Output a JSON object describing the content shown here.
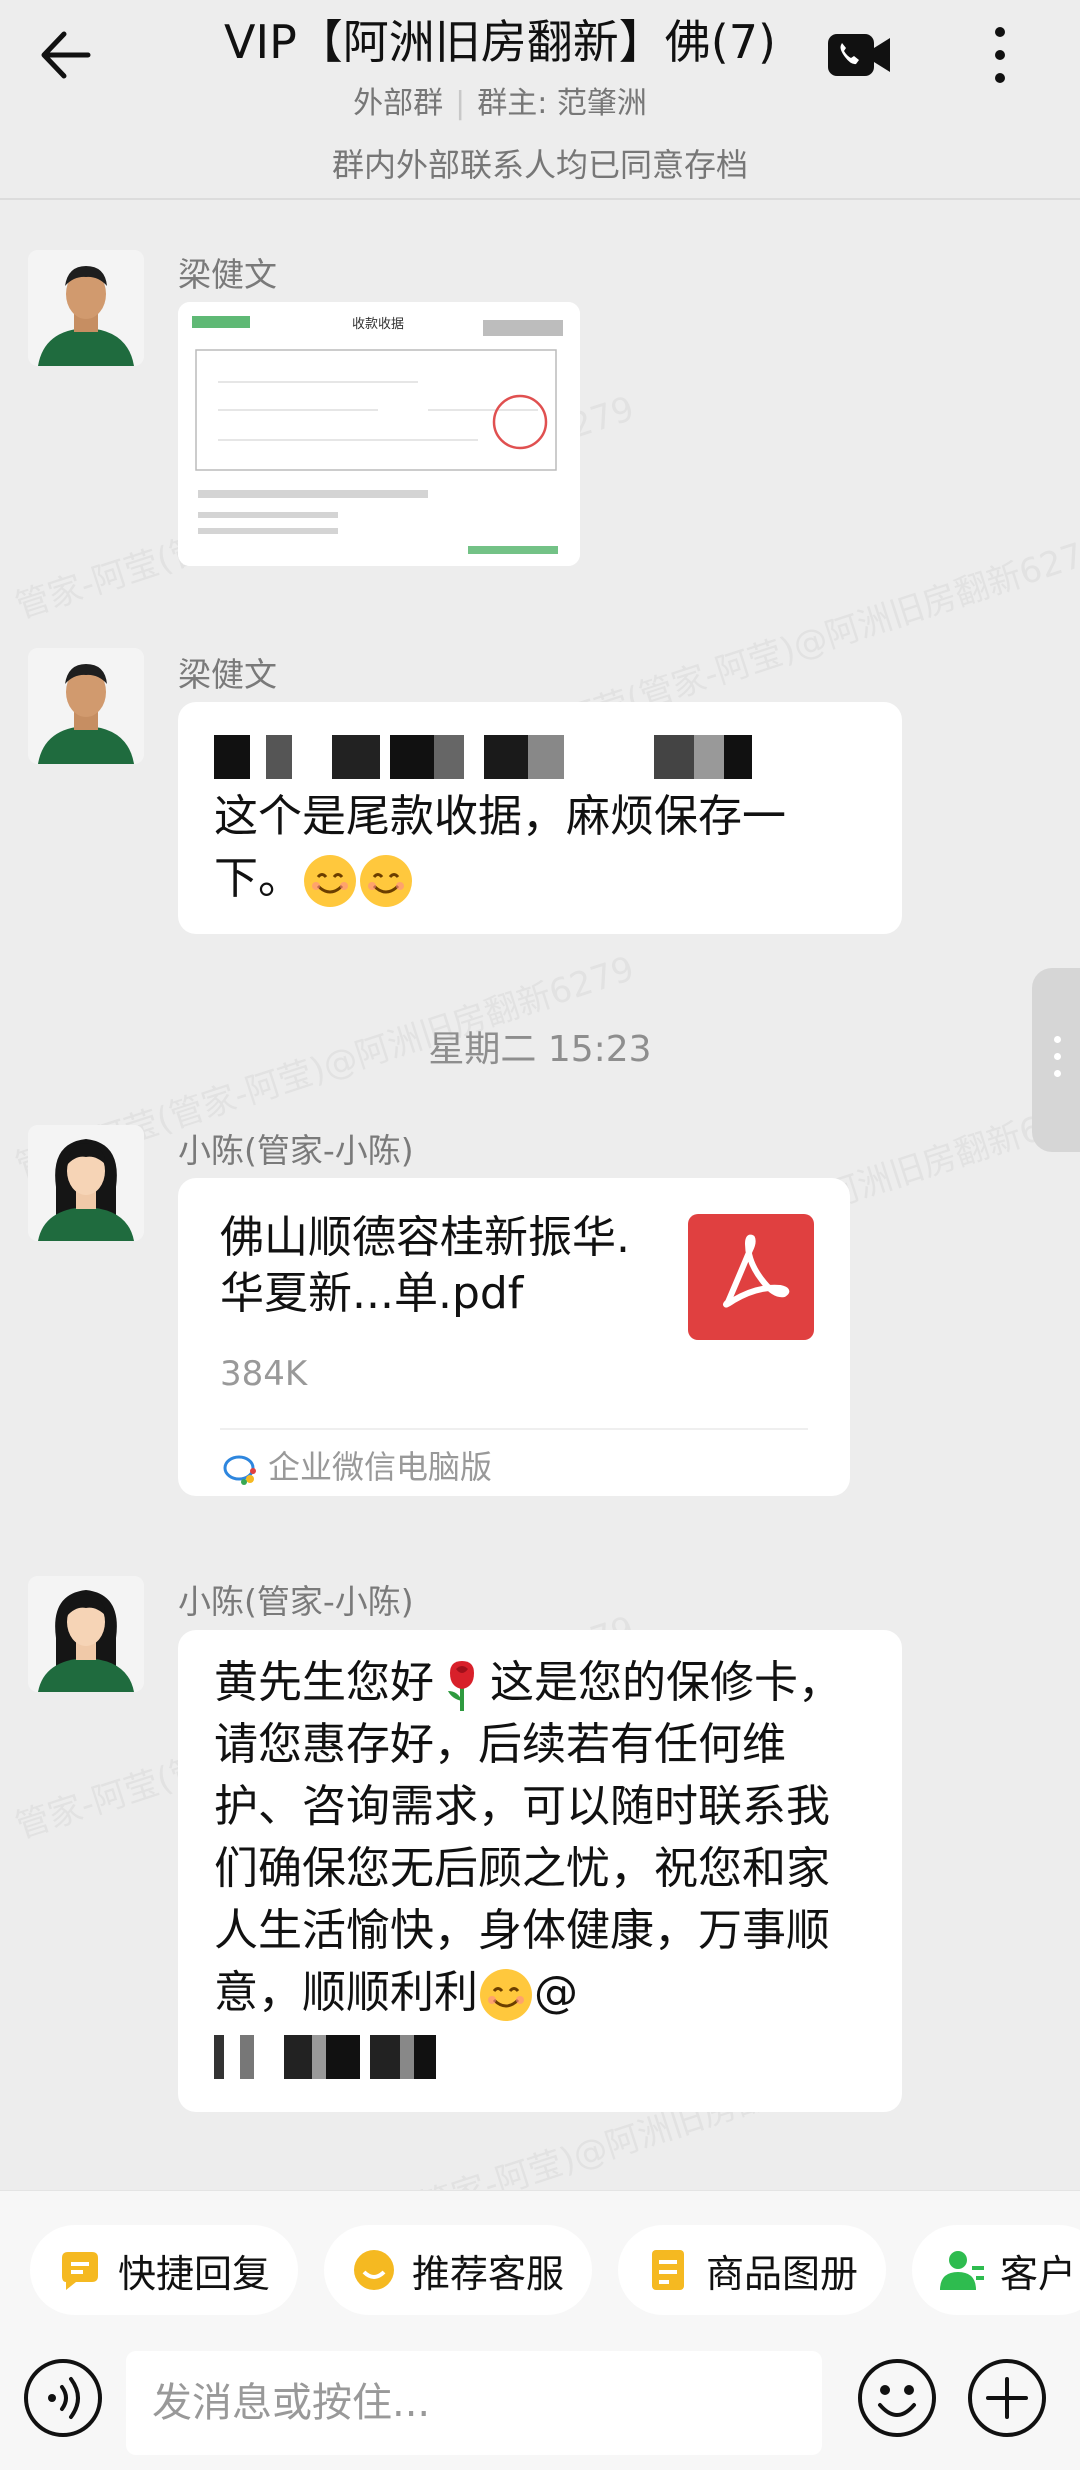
{
  "header": {
    "title": "VIP【阿洲旧房翻新】佛(7)",
    "subtitle_left": "外部群",
    "subtitle_right": "群主: 范肇洲",
    "notice": "群内外部联系人均已同意存档"
  },
  "watermark": "管家-阿莹(管家-阿莹)@阿洲旧房翻新6279",
  "messages": [
    {
      "sender": "梁健文",
      "type": "image",
      "receipt_title": "收款收据"
    },
    {
      "sender": "梁健文",
      "type": "text",
      "text": "这个是尾款收据，麻烦保存一下。"
    },
    {
      "time": "星期二  15:23"
    },
    {
      "sender": "小陈(管家-小陈)",
      "type": "file",
      "file_name": "佛山顺德容桂新振华.华夏新...单.pdf",
      "file_size": "384K",
      "file_source": "企业微信电脑版"
    },
    {
      "sender": "小陈(管家-小陈)",
      "type": "text",
      "text_a": "黄先生您好",
      "text_b": "这是您的保修卡，请您惠存好，后续若有任何维护、咨询需求，可以随时联系我们确保您无后顾之忧，祝您和家人生活愉快，身体健康，万事顺意，顺顺利利",
      "text_c": "@"
    }
  ],
  "quick_replies": [
    {
      "label": "快捷回复",
      "icon": "quick-reply-icon",
      "color": "#f5b921"
    },
    {
      "label": "推荐客服",
      "icon": "service-icon",
      "color": "#f5b921"
    },
    {
      "label": "商品图册",
      "icon": "catalog-icon",
      "color": "#f5b921"
    },
    {
      "label": "客户",
      "icon": "customer-icon",
      "color": "#2ebc4f"
    }
  ],
  "input": {
    "placeholder": "发消息或按住..."
  },
  "colors": {
    "background": "#ededed",
    "bubble": "#ffffff",
    "accent_yellow": "#f5b921",
    "pdf_red": "#e04040"
  }
}
